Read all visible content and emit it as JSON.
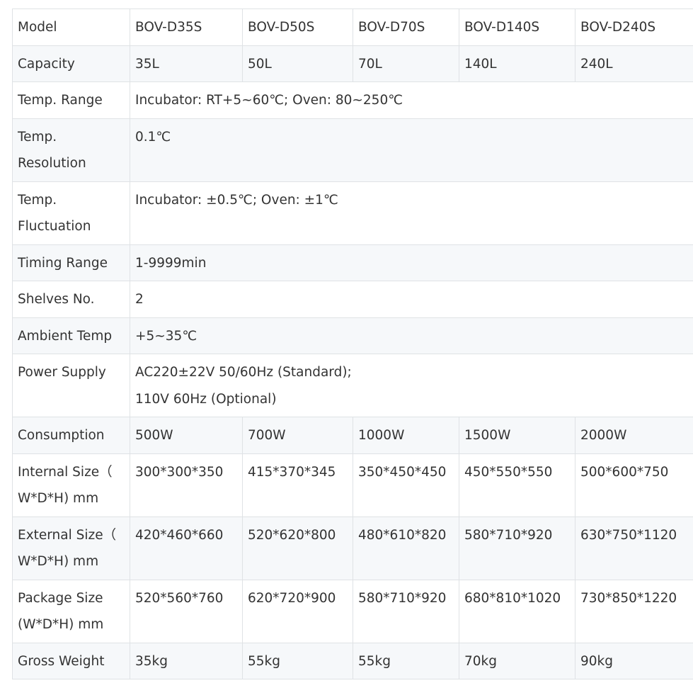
{
  "table": {
    "rows": [
      {
        "label": "Model",
        "cells": [
          "BOV-D35S",
          "BOV-D50S",
          "BOV-D70S",
          "BOV-D140S",
          "BOV-D240S"
        ]
      },
      {
        "label": "Capacity",
        "cells": [
          "35L",
          "50L",
          "70L",
          "140L",
          "240L"
        ]
      },
      {
        "label": "Temp. Range",
        "value": "Incubator: RT+5~60℃; Oven: 80~250℃"
      },
      {
        "label_lines": [
          "Temp.",
          "Resolution"
        ],
        "value": "0.1℃"
      },
      {
        "label_lines": [
          "Temp.",
          "Fluctuation"
        ],
        "value": "Incubator: ±0.5℃; Oven: ±1℃"
      },
      {
        "label": "Timing Range",
        "value": "1-9999min"
      },
      {
        "label": "Shelves No.",
        "value": "2"
      },
      {
        "label": "Ambient Temp",
        "value": "+5~35℃"
      },
      {
        "label": "Power Supply",
        "value_lines": [
          "AC220±22V 50/60Hz (Standard);",
          "110V 60Hz (Optional)"
        ]
      },
      {
        "label": "Consumption",
        "cells": [
          "500W",
          "700W",
          "1000W",
          "1500W",
          "2000W"
        ]
      },
      {
        "label_lines": [
          "Internal Size（",
          "W*D*H) mm"
        ],
        "cells": [
          "300*300*350",
          "415*370*345",
          "350*450*450",
          "450*550*550",
          "500*600*750"
        ]
      },
      {
        "label_lines": [
          "External Size（",
          "W*D*H) mm"
        ],
        "cells": [
          "420*460*660",
          "520*620*800",
          "480*610*820",
          "580*710*920",
          "630*750*1120"
        ]
      },
      {
        "label_lines": [
          "Package Size",
          "(W*D*H) mm"
        ],
        "cells": [
          "520*560*760",
          "620*720*900",
          "580*710*920",
          "680*810*1020",
          "730*850*1220"
        ]
      },
      {
        "label": "Gross Weight",
        "cells": [
          "35kg",
          "55kg",
          "55kg",
          "70kg",
          "90kg"
        ]
      }
    ]
  }
}
